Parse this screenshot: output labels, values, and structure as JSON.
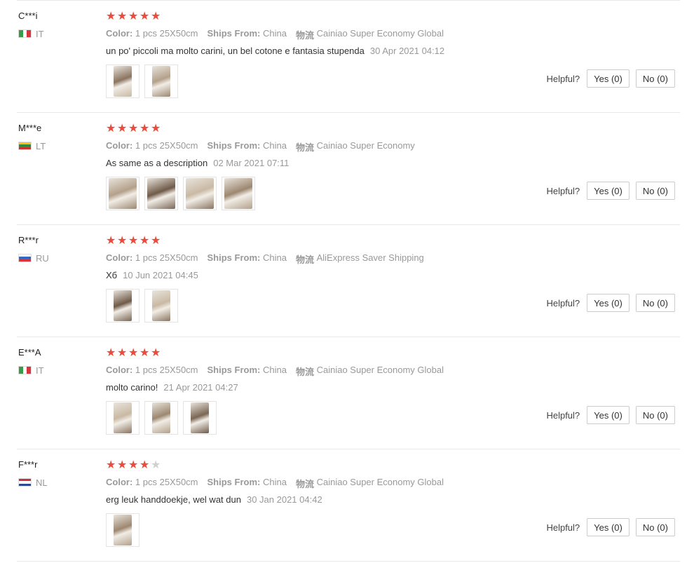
{
  "helpful_label": "Helpful?",
  "labels": {
    "color": "Color:",
    "ships_from": "Ships From:",
    "logistics": "物流"
  },
  "reviews": [
    {
      "user": "C***i",
      "country": "IT",
      "flag": "italy",
      "stars": 5,
      "color": "1 pcs 25X50cm",
      "ships_from": "China",
      "logistics": "Cainiao Super Economy Global",
      "comment": "un po' piccoli ma molto carini, un bel cotone e fantasia stupenda",
      "date": "30 Apr 2021 04:12",
      "photos": 2,
      "yes": "Yes (0)",
      "no": "No (0)"
    },
    {
      "user": "M***e",
      "country": "LT",
      "flag": "lithuania",
      "stars": 5,
      "color": "1 pcs 25X50cm",
      "ships_from": "China",
      "logistics": "Cainiao Super Economy",
      "comment": "As same as a description",
      "date": "02 Mar 2021 07:11",
      "photos": 4,
      "yes": "Yes (0)",
      "no": "No (0)"
    },
    {
      "user": "R***r",
      "country": "RU",
      "flag": "russia",
      "stars": 5,
      "color": "1 pcs 25X50cm",
      "ships_from": "China",
      "logistics": "AliExpress Saver Shipping",
      "comment": "Хб",
      "date": "10 Jun 2021 04:45",
      "photos": 2,
      "yes": "Yes (0)",
      "no": "No (0)"
    },
    {
      "user": "E***A",
      "country": "IT",
      "flag": "italy",
      "stars": 5,
      "color": "1 pcs 25X50cm",
      "ships_from": "China",
      "logistics": "Cainiao Super Economy Global",
      "comment": "molto carino!",
      "date": "21 Apr 2021 04:27",
      "photos": 3,
      "yes": "Yes (0)",
      "no": "No (0)"
    },
    {
      "user": "F***r",
      "country": "NL",
      "flag": "netherlands",
      "stars": 4,
      "color": "1 pcs 25X50cm",
      "ships_from": "China",
      "logistics": "Cainiao Super Economy Global",
      "comment": "erg leuk handdoekje, wel wat dun",
      "date": "30 Jan 2021 04:42",
      "photos": 1,
      "yes": "Yes (0)",
      "no": "No (0)"
    }
  ]
}
